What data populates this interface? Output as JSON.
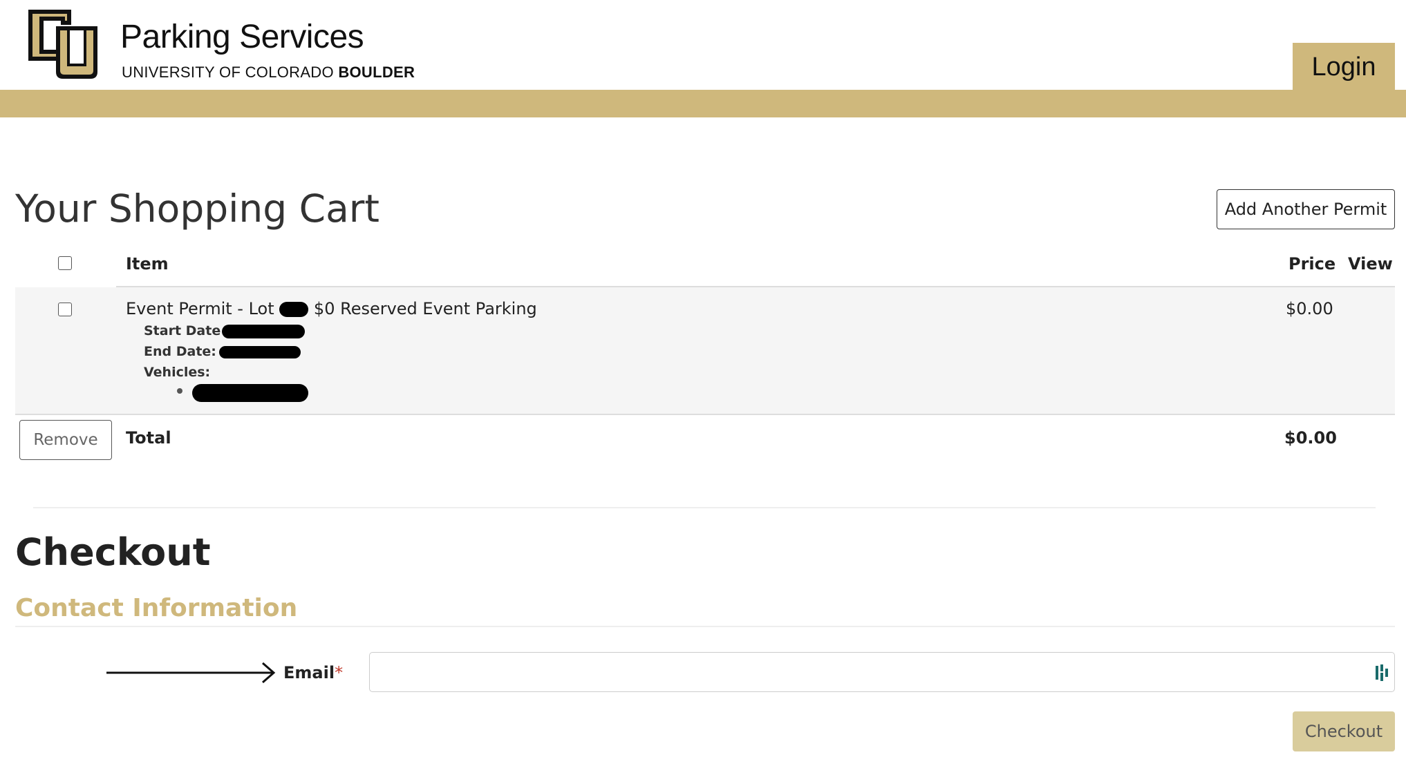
{
  "header": {
    "brand_title": "Parking Services",
    "brand_sub_regular": "UNIVERSITY OF COLORADO ",
    "brand_sub_bold": "BOULDER",
    "login_label": "Login",
    "colors": {
      "gold": "#cfb87c",
      "black": "#111111"
    }
  },
  "cart": {
    "title": "Your Shopping Cart",
    "add_permit_label": "Add Another Permit",
    "columns": {
      "item": "Item",
      "price": "Price",
      "view": "View"
    },
    "row": {
      "name_prefix": "Event Permit - Lot",
      "name_suffix": "$0 Reserved Event Parking",
      "start_date_label": "Start Date",
      "end_date_label": "End Date:",
      "vehicles_label": "Vehicles:",
      "price": "$0.00"
    },
    "remove_label": "Remove",
    "total_label": "Total",
    "total_value": "$0.00"
  },
  "checkout": {
    "title": "Checkout",
    "contact_title": "Contact Information",
    "email_label": "Email",
    "required_mark": "*",
    "email_value": "",
    "button_label": "Checkout"
  }
}
